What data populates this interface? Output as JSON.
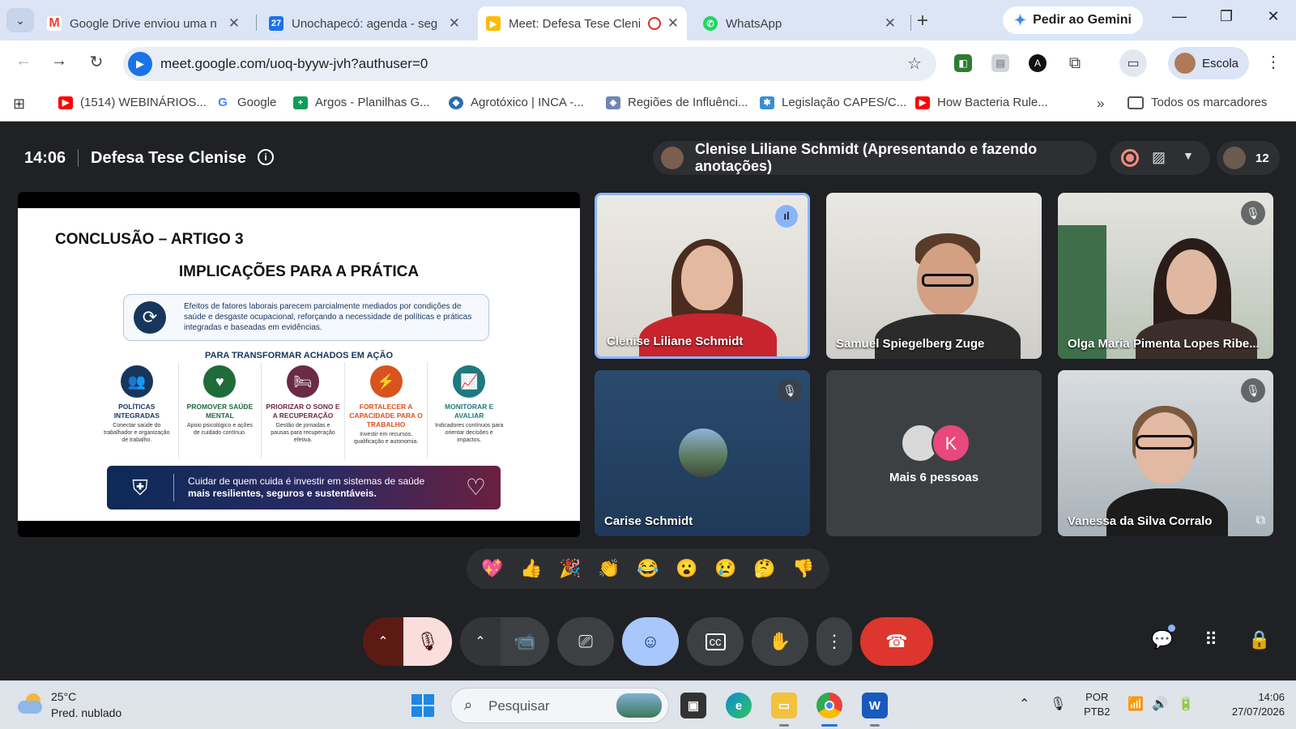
{
  "browser": {
    "tabs": [
      {
        "title": "Google Drive enviou uma n",
        "icon": "gmail-icon"
      },
      {
        "title": "Unochapecó: agenda - seg",
        "icon": "calendar-icon"
      },
      {
        "title": "Meet: Defesa Tese Cleni",
        "icon": "meet-icon",
        "active": true
      },
      {
        "title": "WhatsApp",
        "icon": "whatsapp-icon"
      }
    ],
    "gemini_label": "Pedir ao Gemini",
    "url": "meet.google.com/uoq-byyw-jvh?authuser=0",
    "profile_label": "Escola",
    "bookmarks": [
      {
        "label": "(1514) WEBINÁRIOS...",
        "icon": "youtube-icon"
      },
      {
        "label": "Google",
        "icon": "google-icon"
      },
      {
        "label": "Argos - Planilhas G...",
        "icon": "sheets-icon"
      },
      {
        "label": "Agrotóxico | INCA -...",
        "icon": "inca-icon"
      },
      {
        "label": "Regiões de Influênci...",
        "icon": "ibge-icon"
      },
      {
        "label": "Legislação CAPES/C...",
        "icon": "capes-icon"
      },
      {
        "label": "How Bacteria Rule...",
        "icon": "youtube-icon"
      }
    ],
    "all_bookmarks_label": "Todos os marcadores"
  },
  "meet": {
    "time": "14:06",
    "title": "Defesa Tese Clenise",
    "presenter": "Clenise Liliane Schmidt (Apresentando e fazendo anotações)",
    "participant_count": "12",
    "slide": {
      "title": "CONCLUSÃO – ARTIGO 3",
      "subtitle": "IMPLICAÇÕES PARA A PRÁTICA",
      "box_text": "Efeitos de fatores laborais parecem parcialmente mediados por condições de saúde e desgaste ocupacional, reforçando a necessidade de políticas e práticas integradas e baseadas em evidências.",
      "section_title": "PARA TRANSFORMAR ACHADOS EM AÇÃO",
      "cards": [
        {
          "title": "POLÍTICAS INTEGRADAS",
          "desc": "Conectar saúde do trabalhador e organização de trabalho.",
          "color": "#17365d"
        },
        {
          "title": "PROMOVER SAÚDE MENTAL",
          "desc": "Apoio psicológico e ações de cuidado contínuo.",
          "color": "#1f6b3a"
        },
        {
          "title": "PRIORIZAR O SONO E A RECUPERAÇÃO",
          "desc": "Gestão de jornadas e pausas para recuperação efetiva.",
          "color": "#6b2a45"
        },
        {
          "title": "FORTALECER A CAPACIDADE PARA O TRABALHO",
          "desc": "Investir em recursos, qualificação e autonomia.",
          "color": "#d9531e"
        },
        {
          "title": "MONITORAR E AVALIAR",
          "desc": "Indicadores contínuos para orientar decisões e impactos.",
          "color": "#1d7a80"
        }
      ],
      "banner_text_1": "Cuidar de quem cuida é investir em sistemas de saúde",
      "banner_text_2": "mais resilientes, seguros e sustentáveis."
    },
    "participants": [
      {
        "name": "Clenise Liliane Schmidt",
        "status": "speaking"
      },
      {
        "name": "Samuel Spiegelberg Zuge",
        "status": "unmuted"
      },
      {
        "name": "Olga Maria Pimenta Lopes Ribe...",
        "status": "muted"
      },
      {
        "name": "Carise Schmidt",
        "status": "muted"
      },
      {
        "name": "Mais 6 pessoas",
        "avatar_letter": "K"
      },
      {
        "name": "Vanessa da Silva Corralo",
        "status": "muted"
      }
    ],
    "reactions": [
      "💖",
      "👍",
      "🎉",
      "👏",
      "😂",
      "😮",
      "😢",
      "🤔",
      "👎"
    ]
  },
  "taskbar": {
    "temperature": "25°C",
    "condition": "Pred. nublado",
    "search_placeholder": "Pesquisar",
    "lang_1": "POR",
    "lang_2": "PTB2",
    "clock_time": "14:06",
    "clock_date": "27/07/2026"
  }
}
